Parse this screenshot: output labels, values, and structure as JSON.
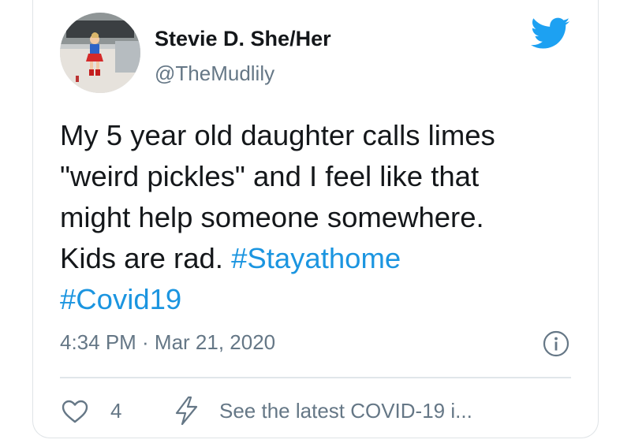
{
  "tweet": {
    "display_name": "Stevie D. She/Her",
    "handle": "@TheMudlily",
    "text_lines": [
      "My 5 year old daughter calls limes",
      "\"weird pickles\" and I feel like that",
      "might help someone somewhere.",
      "Kids are rad. "
    ],
    "hashtags": [
      "#Stayathome",
      "#Covid19"
    ],
    "timestamp": "4:34 PM · Mar 21, 2020",
    "like_count": "4",
    "covid_link": "See the latest COVID-19 i..."
  },
  "icons": {
    "brand": "twitter-bird-icon",
    "info": "info-icon",
    "like": "heart-icon",
    "covid": "lightning-bolt-icon"
  },
  "colors": {
    "twitter_blue": "#1da1f2",
    "hashtag_blue": "#1b95e0",
    "text": "#14171a",
    "secondary": "#657786",
    "border": "#dfe3e6"
  }
}
